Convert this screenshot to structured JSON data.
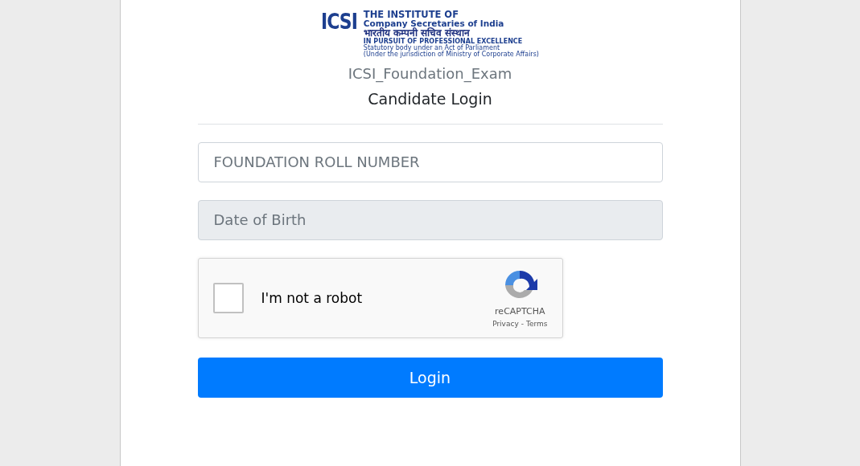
{
  "logo": {
    "mark": "ICSI",
    "title_line_1": "THE INSTITUTE OF",
    "title_line_2": "Company Secretaries of India",
    "hindi": "भारतीय कम्पनी सचिव संस्थान",
    "motto": "IN PURSUIT OF PROFESSIONAL EXCELLENCE",
    "statute_line_1": "Statutory body under an Act of Parliament",
    "statute_line_2": "(Under the jurisdiction of Ministry of Corporate Affairs)"
  },
  "exam_name": "ICSI_Foundation_Exam",
  "heading": "Candidate Login",
  "fields": [
    {
      "placeholder": "FOUNDATION ROLL NUMBER",
      "disabled": false
    },
    {
      "placeholder": "Date of Birth",
      "disabled": true
    }
  ],
  "captcha": {
    "label": "I'm not a robot",
    "checked": false,
    "brand": "reCAPTCHA",
    "privacy": "Privacy",
    "separator": "-",
    "terms": "Terms"
  },
  "login_button": "Login"
}
